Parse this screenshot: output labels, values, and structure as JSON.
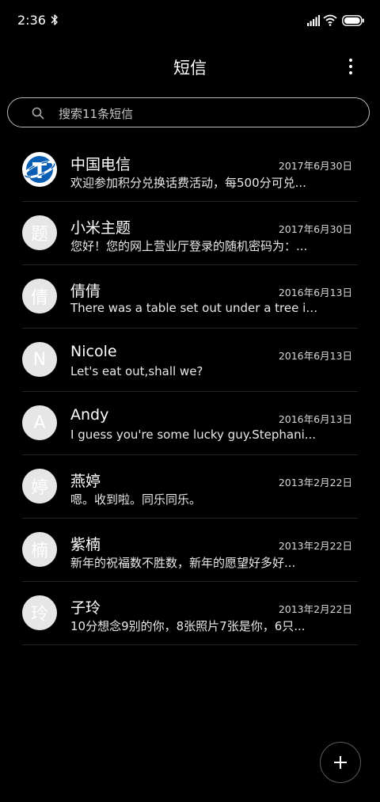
{
  "status_bar": {
    "time": "2:36",
    "icons": [
      "bluetooth-icon",
      "signal-icon",
      "wifi-icon",
      "battery-icon"
    ]
  },
  "header": {
    "title": "短信",
    "menu_icon": "more-vertical-icon"
  },
  "search": {
    "placeholder": "搜索11条短信",
    "icon": "search-icon"
  },
  "conversations": [
    {
      "avatar": "",
      "avatar_type": "china-telecom-logo",
      "name": "中国电信",
      "date": "2017年6月30日",
      "preview": "欢迎参加积分兑换话费活动，每500分可兑..."
    },
    {
      "avatar": "题",
      "name": "小米主题",
      "date": "2017年6月30日",
      "preview": "您好！您的网上营业厅登录的随机密码为：..."
    },
    {
      "avatar": "倩",
      "name": "倩倩",
      "date": "2016年6月13日",
      "preview": "There was a table set out under a tree in..."
    },
    {
      "avatar": "N",
      "name": "Nicole",
      "date": "2016年6月13日",
      "preview": "Let's eat out,shall we?"
    },
    {
      "avatar": "A",
      "name": "Andy",
      "date": "2016年6月13日",
      "preview": "I guess you're some lucky guy.Stephani..."
    },
    {
      "avatar": "婷",
      "name": "燕婷",
      "date": "2013年2月22日",
      "preview": "嗯。收到啦。同乐同乐。"
    },
    {
      "avatar": "楠",
      "name": "紫楠",
      "date": "2013年2月22日",
      "preview": "新年的祝福数不胜数，新年的愿望好多好..."
    },
    {
      "avatar": "玲",
      "name": "子玲",
      "date": "2013年2月22日",
      "preview": "10分想念9别的你，8张照片7张是你，6只..."
    }
  ],
  "fab": {
    "icon": "plus-icon"
  },
  "colors": {
    "background": "#000000",
    "avatar_bg": "#e6e6e6",
    "divider": "#262626",
    "telecom_blue": "#0a5fb4"
  }
}
